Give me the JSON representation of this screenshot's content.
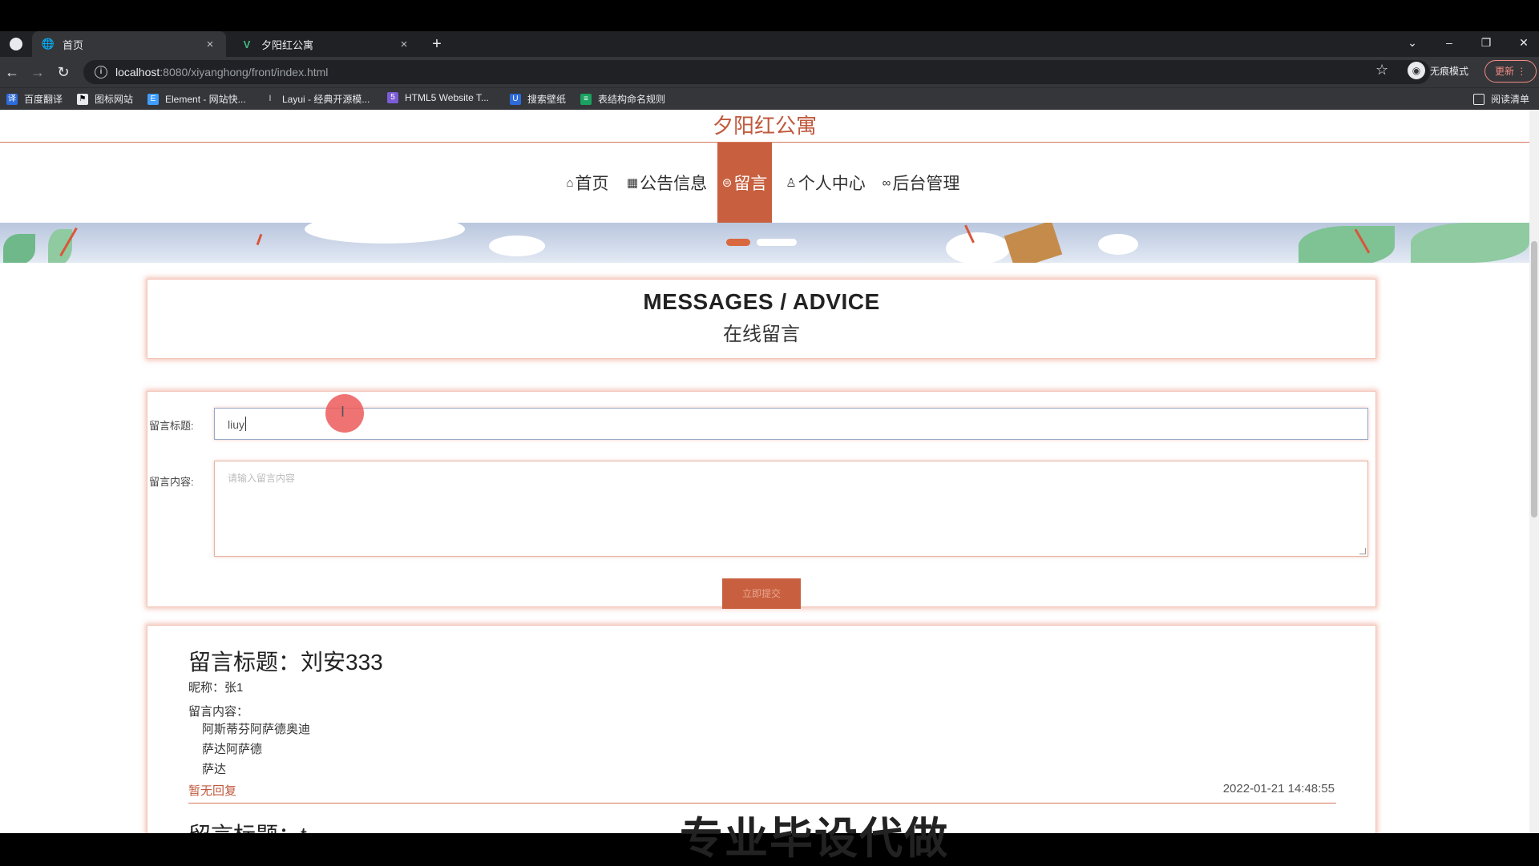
{
  "browser": {
    "tabs": [
      {
        "label": "首页",
        "icon": "globe-icon",
        "active": true
      },
      {
        "label": "夕阳红公寓",
        "icon": "vue-icon",
        "active": false
      }
    ],
    "close_glyph": "×",
    "newtab_glyph": "+",
    "url_host": "localhost",
    "url_path": ":8080/xiyanghong/front/index.html",
    "incognito_label": "无痕模式",
    "update_label": "更新",
    "bookmarks": [
      {
        "label": "百度翻译",
        "color": "#2d6bdb"
      },
      {
        "label": "图标网站",
        "color": "#000000"
      },
      {
        "label": "Element - 网站快...",
        "color": "#409eff"
      },
      {
        "label": "Layui - 经典开源模...",
        "color": "#333333"
      },
      {
        "label": "HTML5 Website T...",
        "color": "#7b5cd6"
      },
      {
        "label": "搜索壁纸",
        "color": "#2d6bdb"
      },
      {
        "label": "表结构命名规则",
        "color": "#1aa260"
      }
    ],
    "reading_list": "阅读清单"
  },
  "site": {
    "title": "夕阳红公寓",
    "nav": [
      {
        "label": "首页",
        "icon": "home-icon",
        "glyph": "⌂",
        "active": false
      },
      {
        "label": "公告信息",
        "icon": "grid-icon",
        "glyph": "▦",
        "active": false
      },
      {
        "label": "留言",
        "icon": "message-icon",
        "glyph": "⊜",
        "active": true
      },
      {
        "label": "个人中心",
        "icon": "user-icon",
        "glyph": "♙",
        "active": false
      },
      {
        "label": "后台管理",
        "icon": "link-icon",
        "glyph": "∞",
        "active": false
      }
    ],
    "accent": "#c8603f"
  },
  "header": {
    "en": "MESSAGES / ADVICE",
    "cn": "在线留言"
  },
  "form": {
    "title_label": "留言标题:",
    "title_value": "liuy",
    "content_label": "留言内容:",
    "content_placeholder": "请输入留言内容",
    "submit_label": "立即提交"
  },
  "messages": [
    {
      "title": "留言标题：刘安333",
      "nickname": "昵称：张1",
      "content_label": "留言内容：",
      "content_lines": [
        "阿斯蒂芬阿萨德奥迪",
        "萨达阿萨德",
        "萨达"
      ],
      "reply": "暂无回复",
      "time": "2022-01-21 14:48:55"
    },
    {
      "title": "留言标题：t"
    }
  ],
  "overlay": "专业毕设代做"
}
